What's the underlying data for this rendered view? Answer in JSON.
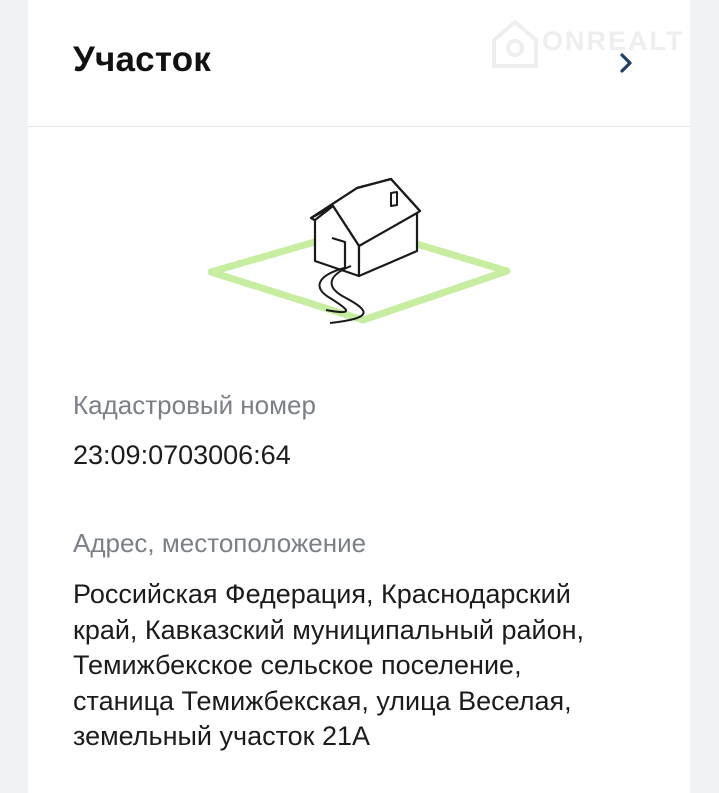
{
  "header": {
    "title": "Участок",
    "watermark_text": "ONREALT"
  },
  "plot": {
    "cadastral_label": "Кадастровый номер",
    "cadastral_number": "23:09:0703006:64",
    "address_label": "Адрес, местоположение",
    "address_lines": [
      "Российская Федерация, Краснодарский",
      "край, Кавказский муниципальный район,",
      "Темижбекское сельское поселение,",
      "станица Темижбекская, улица Веселая,",
      "земельный участок 21А"
    ]
  },
  "icons": {
    "header_chevron": "chevron-right-icon",
    "illustration": "house-on-plot-illustration",
    "watermark": "onrealt-logo"
  },
  "colors": {
    "accent_chevron": "#1f3f66",
    "plot_outline": "#c6eda0",
    "label_gray": "#7b7f87"
  }
}
